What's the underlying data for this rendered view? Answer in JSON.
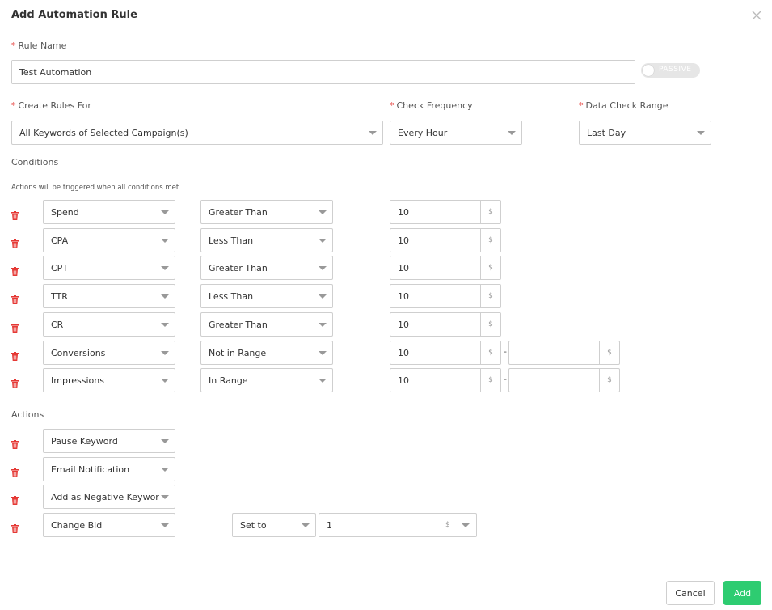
{
  "dialog": {
    "title": "Add Automation Rule",
    "rule_name_label": "Rule Name",
    "rule_name_value": "Test Automation",
    "toggle_label": "PASSIVE",
    "create_rules_label": "Create Rules For",
    "create_rules_value": "All Keywords of Selected Campaign(s)",
    "check_frequency_label": "Check Frequency",
    "check_frequency_value": "Every Hour",
    "data_range_label": "Data Check Range",
    "data_range_value": "Last Day",
    "conditions_label": "Conditions",
    "conditions_hint": "Actions will be triggered when all conditions met",
    "actions_label": "Actions",
    "required_mark": "*"
  },
  "conditions": [
    {
      "metric": "Spend",
      "operator": "Greater Than",
      "value": "10",
      "unit": "$"
    },
    {
      "metric": "CPA",
      "operator": "Less Than",
      "value": "10",
      "unit": "$"
    },
    {
      "metric": "CPT",
      "operator": "Greater Than",
      "value": "10",
      "unit": "$"
    },
    {
      "metric": "TTR",
      "operator": "Less Than",
      "value": "10",
      "unit": "$"
    },
    {
      "metric": "CR",
      "operator": "Greater Than",
      "value": "10",
      "unit": "$"
    },
    {
      "metric": "Conversions",
      "operator": "Not in Range",
      "value": "10",
      "unit": "$",
      "value2": "",
      "unit2": "$",
      "range_sep": "-"
    },
    {
      "metric": "Impressions",
      "operator": "In Range",
      "value": "10",
      "unit": "$",
      "value2": "",
      "unit2": "$",
      "range_sep": "-"
    }
  ],
  "actions": [
    {
      "action": "Pause Keyword"
    },
    {
      "action": "Email Notification"
    },
    {
      "action": "Add as Negative Keywor"
    },
    {
      "action": "Change Bid",
      "bid_mode": "Set to",
      "bid_value": "1",
      "bid_unit": "$"
    }
  ],
  "footer": {
    "cancel_label": "Cancel",
    "add_label": "Add"
  },
  "colors": {
    "required": "#e53935",
    "trash": "#e53935",
    "add_button": "#2ecc71",
    "toggle_off": "#e6e6e6"
  },
  "icons": [
    "close-icon",
    "trash-icon",
    "chevron-down-icon"
  ]
}
